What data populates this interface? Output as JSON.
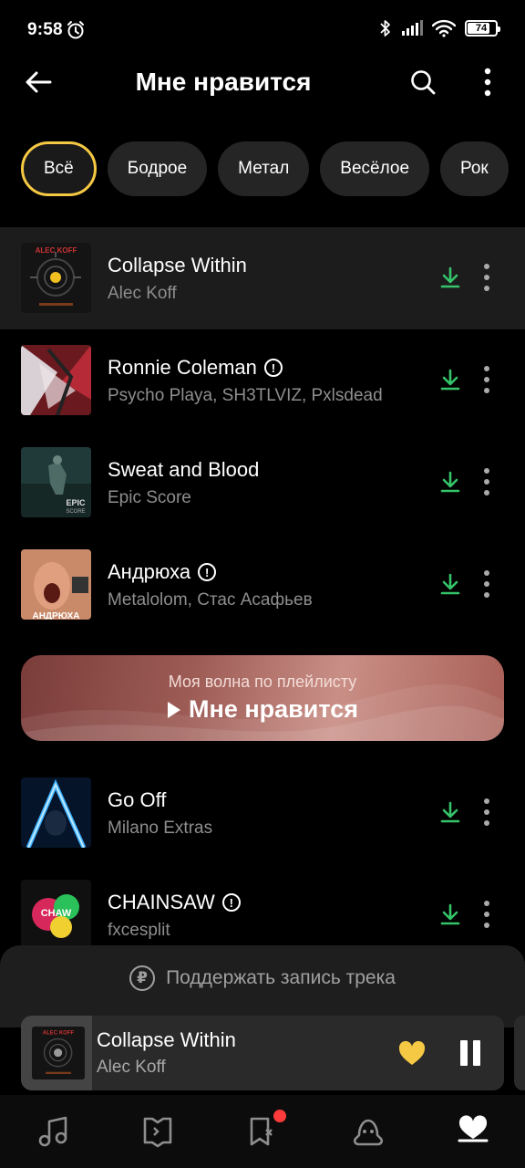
{
  "status": {
    "time": "9:58",
    "battery": "74"
  },
  "header": {
    "title": "Мне нравится"
  },
  "chips": [
    "Всё",
    "Бодрое",
    "Метал",
    "Весёлое",
    "Рок"
  ],
  "tracks": [
    {
      "title": "Collapse Within",
      "artist": "Alec Koff",
      "explicit": false,
      "cover_label": "ALEC KOFF"
    },
    {
      "title": "Ronnie Coleman",
      "artist": "Psycho Playa, SH3TLVIZ, Pxlsdead",
      "explicit": true
    },
    {
      "title": "Sweat and Blood",
      "artist": "Epic Score",
      "explicit": false,
      "cover_label": "EPIC SCORE"
    },
    {
      "title": "Андрюха",
      "artist": "Metalolom, Стас Асафьев",
      "explicit": true,
      "cover_label": "АНДРЮХА"
    },
    {
      "title": "Go Off",
      "artist": "Milano Extras",
      "explicit": false
    },
    {
      "title": "CHAINSAW",
      "artist": "fxcesplit",
      "explicit": true
    }
  ],
  "wave": {
    "subtitle": "Моя волна по плейлисту",
    "title": "Мне нравится"
  },
  "support": {
    "label": "Поддержать запись трека",
    "currency_symbol": "₽"
  },
  "player": {
    "title": "Collapse Within",
    "artist": "Alec Koff"
  },
  "nav": [
    "music-icon",
    "map-icon",
    "bookmark-icon",
    "kids-icon",
    "heart-icon"
  ],
  "colors": {
    "accent": "#f6c944",
    "download": "#35c46a",
    "badge": "#ff3b3b"
  }
}
